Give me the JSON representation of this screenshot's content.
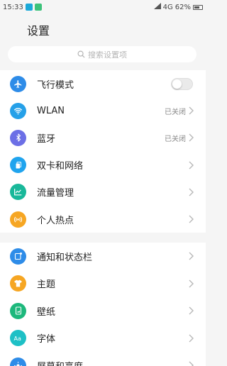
{
  "status_bar": {
    "time": "15:33",
    "network": "4G",
    "battery": "62%"
  },
  "page": {
    "title": "设置"
  },
  "search": {
    "placeholder": "搜索设置项"
  },
  "section1": [
    {
      "label": "飞行模式",
      "color": "#2e8ce8",
      "icon": "airplane-icon",
      "control": "toggle",
      "toggle_on": false
    },
    {
      "label": "WLAN",
      "color": "#25a0e8",
      "icon": "wifi-icon",
      "status": "已关闭"
    },
    {
      "label": "蓝牙",
      "color": "#6c6fe6",
      "icon": "bluetooth-icon",
      "status": "已关闭"
    },
    {
      "label": "双卡和网络",
      "color": "#20a4ee",
      "icon": "sim-card-icon"
    },
    {
      "label": "流量管理",
      "color": "#19b89a",
      "icon": "chart-icon"
    },
    {
      "label": "个人热点",
      "color": "#f6a623",
      "icon": "hotspot-icon"
    }
  ],
  "section2": [
    {
      "label": "通知和状态栏",
      "color": "#2e8ce8",
      "icon": "notification-icon"
    },
    {
      "label": "主题",
      "color": "#f6a623",
      "icon": "theme-icon"
    },
    {
      "label": "壁纸",
      "color": "#1db87c",
      "icon": "wallpaper-icon"
    },
    {
      "label": "字体",
      "color": "#1ec0c6",
      "icon": "font-icon"
    },
    {
      "label": "屏幕和亮度",
      "color": "#2e8ce8",
      "icon": "brightness-icon"
    }
  ]
}
